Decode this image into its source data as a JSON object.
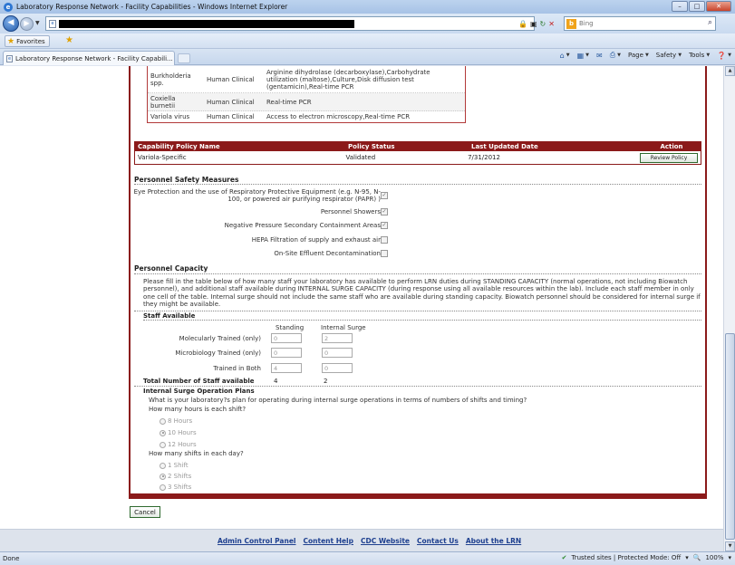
{
  "window": {
    "title": "Laboratory Response Network - Facility Capabilities - Windows Internet Explorer"
  },
  "toolbar": {
    "search_placeholder": "Bing"
  },
  "favorites": {
    "label": "Favorites"
  },
  "tab": {
    "label": "Laboratory Response Network - Facility Capabili..."
  },
  "commands": {
    "page": "Page",
    "safety": "Safety",
    "tools": "Tools"
  },
  "organisms": [
    {
      "agent": "Burkholderia spp.",
      "type": "Human Clinical",
      "methods": "Arginine dihydrolase (decarboxylase),Carbohydrate utilization (maltose),Culture,Disk diffusion test (gentamicin),Real-time PCR"
    },
    {
      "agent": "Coxiella burnetii",
      "type": "Human Clinical",
      "methods": "Real-time PCR"
    },
    {
      "agent": "Variola virus",
      "type": "Human Clinical",
      "methods": "Access to electron microscopy,Real-time PCR"
    }
  ],
  "policy": {
    "headers": [
      "Capability Policy Name",
      "Policy Status",
      "Last Updated Date",
      "Action"
    ],
    "row": {
      "name": "Variola-Specific",
      "status": "Validated",
      "date": "7/31/2012",
      "action": "Review Policy"
    }
  },
  "safety": {
    "title": "Personnel Safety Measures",
    "items": [
      {
        "label": "Eye Protection and the use of Respiratory Protective Equipment (e.g. N-95, N-100, or powered air purifying respirator (PAPR) )",
        "checked": true
      },
      {
        "label": "Personnel Showers",
        "checked": true
      },
      {
        "label": "Negative Pressure Secondary Containment Areas",
        "checked": true
      },
      {
        "label": "HEPA Filtration of supply and exhaust air",
        "checked": false
      },
      {
        "label": "On-Site Effluent Decontamination",
        "checked": false
      }
    ]
  },
  "capacity": {
    "title": "Personnel Capacity",
    "instructions": "Please fill in the table below of how many staff your laboratory has available to perform LRN duties during STANDING CAPACITY (normal operations, not including Biowatch personnel), and additional staff available during INTERNAL SURGE CAPACITY (during response using all available resources within the lab). Include each staff member in only one cell of the table. Internal surge should not include the same staff who are available during standing capacity. Biowatch personnel should be considered for internal surge if they might be available.",
    "staff_title": "Staff Available",
    "col_standing": "Standing",
    "col_surge": "Internal Surge",
    "rows": [
      {
        "label": "Molecularly Trained (only)",
        "standing": "0",
        "surge": "2"
      },
      {
        "label": "Microbiology Trained (only)",
        "standing": "0",
        "surge": "0"
      },
      {
        "label": "Trained in Both",
        "standing": "4",
        "surge": "0"
      }
    ],
    "total_label": "Total Number of Staff available",
    "total_standing": "4",
    "total_surge": "2"
  },
  "surge": {
    "title": "Internal Surge Operation Plans",
    "question": "What is your laboratory?s plan for operating during internal surge operations in terms of numbers of shifts and timing?",
    "hours_question": "How many hours is each shift?",
    "hours_options": [
      "8 Hours",
      "10 Hours",
      "12 Hours"
    ],
    "hours_selected": "10 Hours",
    "shifts_question": "How many shifts in each day?",
    "shifts_options": [
      "1 Shift",
      "2 Shifts",
      "3 Shifts"
    ],
    "shifts_selected": "2 Shifts"
  },
  "cancel_label": "Cancel",
  "footer_links": [
    "Admin Control Panel",
    "Content Help",
    "CDC Website",
    "Contact Us",
    "About the LRN"
  ],
  "status": {
    "left": "Done",
    "zone": "Trusted sites | Protected Mode: Off",
    "zoom": "100%"
  },
  "colors": {
    "accent": "#8b1a1a",
    "link": "#1d3f8f"
  }
}
